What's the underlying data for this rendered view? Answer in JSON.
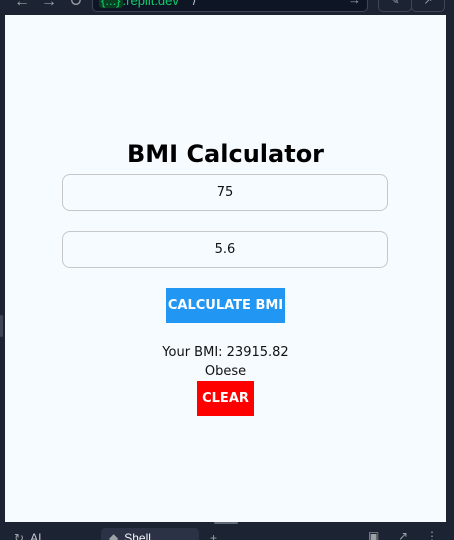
{
  "browser": {
    "url_domain_badge": "{...}",
    "url_domain": ".replit.dev",
    "url_path": "/",
    "nav_back_icon": "arrow-left-icon",
    "nav_forward_icon": "arrow-right-icon",
    "nav_reload_icon": "reload-icon"
  },
  "app": {
    "title": "BMI Calculator",
    "weight_value": "75",
    "height_value": "5.6",
    "calculate_label": "CALCULATE BMI",
    "result_bmi": "Your BMI: 23915.82",
    "result_category": "Obese",
    "clear_label": "CLEAR"
  },
  "bottom_tabs": {
    "ai_label": "AI",
    "shell_label": "Shell",
    "add_label": "+"
  },
  "colors": {
    "page_background": "#f5fbff",
    "calculate_button": "#2196f3",
    "clear_button": "#ff0000",
    "chrome_background": "#1c2333"
  }
}
